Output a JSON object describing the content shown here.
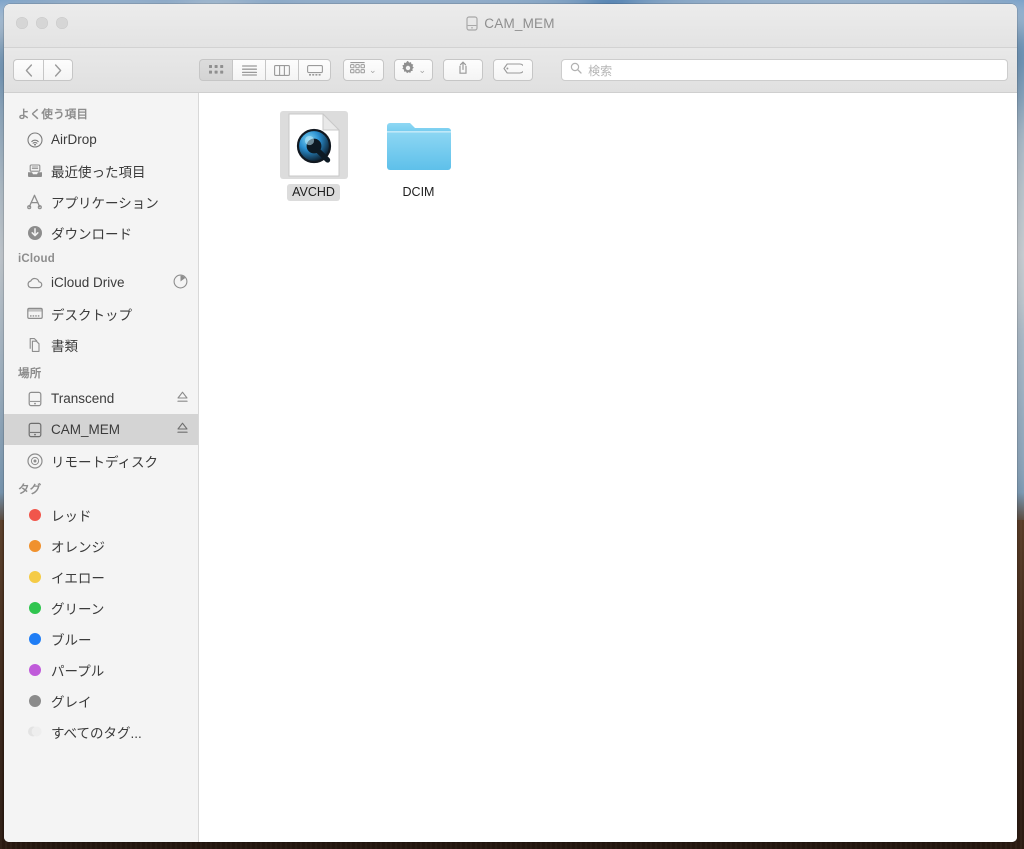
{
  "window": {
    "title": "CAM_MEM",
    "title_icon": "drive-icon",
    "traffic_lights": [
      "close-button",
      "minimize-button",
      "zoom-button"
    ]
  },
  "toolbar": {
    "nav": [
      {
        "name": "back-button",
        "glyph": "‹"
      },
      {
        "name": "forward-button",
        "glyph": "›"
      }
    ],
    "view_modes": [
      {
        "name": "icon-view-button",
        "icon": "grid-icon",
        "active": true
      },
      {
        "name": "list-view-button",
        "icon": "list-icon",
        "active": false
      },
      {
        "name": "column-view-button",
        "icon": "columns-icon",
        "active": false
      },
      {
        "name": "gallery-view-button",
        "icon": "gallery-icon",
        "active": false
      }
    ],
    "arrange_button": {
      "name": "arrange-by-button",
      "icon": "arrange-grid-icon",
      "chevron": "⌄"
    },
    "action_button": {
      "name": "action-button",
      "icon": "gear-icon",
      "chevron": "⌄"
    },
    "share_button": {
      "name": "share-button",
      "icon": "share-icon"
    },
    "tag_button": {
      "name": "tag-button",
      "icon": "tag-icon"
    }
  },
  "search": {
    "placeholder": "検索",
    "value": "",
    "icon": "search-icon"
  },
  "sidebar": {
    "sections": [
      {
        "title": "よく使う項目",
        "items": [
          {
            "label": "AirDrop",
            "icon": "airdrop-icon",
            "selected": false
          },
          {
            "label": "最近使った項目",
            "icon": "recents-icon",
            "selected": false
          },
          {
            "label": "アプリケーション",
            "icon": "applications-icon",
            "selected": false
          },
          {
            "label": "ダウンロード",
            "icon": "downloads-icon",
            "selected": false
          }
        ]
      },
      {
        "title": "iCloud",
        "items": [
          {
            "label": "iCloud Drive",
            "icon": "cloud-icon",
            "selected": false,
            "accessory": "pie-progress-icon"
          },
          {
            "label": "デスクトップ",
            "icon": "desktop-icon",
            "selected": false
          },
          {
            "label": "書類",
            "icon": "documents-icon",
            "selected": false
          }
        ]
      },
      {
        "title": "場所",
        "items": [
          {
            "label": "Transcend",
            "icon": "drive-icon",
            "selected": false,
            "accessory": "eject-icon"
          },
          {
            "label": "CAM_MEM",
            "icon": "drive-icon",
            "selected": true,
            "accessory": "eject-icon"
          },
          {
            "label": "リモートディスク",
            "icon": "remote-disc-icon",
            "selected": false
          }
        ]
      },
      {
        "title": "タグ",
        "items": [
          {
            "label": "レッド",
            "icon": "tag-dot-icon",
            "color": "#f1564b",
            "selected": false
          },
          {
            "label": "オレンジ",
            "icon": "tag-dot-icon",
            "color": "#f0912d",
            "selected": false
          },
          {
            "label": "イエロー",
            "icon": "tag-dot-icon",
            "color": "#f5cb46",
            "selected": false
          },
          {
            "label": "グリーン",
            "icon": "tag-dot-icon",
            "color": "#30c54f",
            "selected": false
          },
          {
            "label": "ブルー",
            "icon": "tag-dot-icon",
            "color": "#1f7df5",
            "selected": false
          },
          {
            "label": "パープル",
            "icon": "tag-dot-icon",
            "color": "#c05bda",
            "selected": false
          },
          {
            "label": "グレイ",
            "icon": "tag-dot-icon",
            "color": "#8b8b8b",
            "selected": false
          },
          {
            "label": "すべてのタグ...",
            "icon": "all-tags-icon",
            "color": "#e0e0e0",
            "selected": false
          }
        ]
      }
    ]
  },
  "content": {
    "files": [
      {
        "name": "AVCHD",
        "kind": "quicktime-document",
        "selected": true
      },
      {
        "name": "DCIM",
        "kind": "folder",
        "selected": false
      }
    ]
  }
}
